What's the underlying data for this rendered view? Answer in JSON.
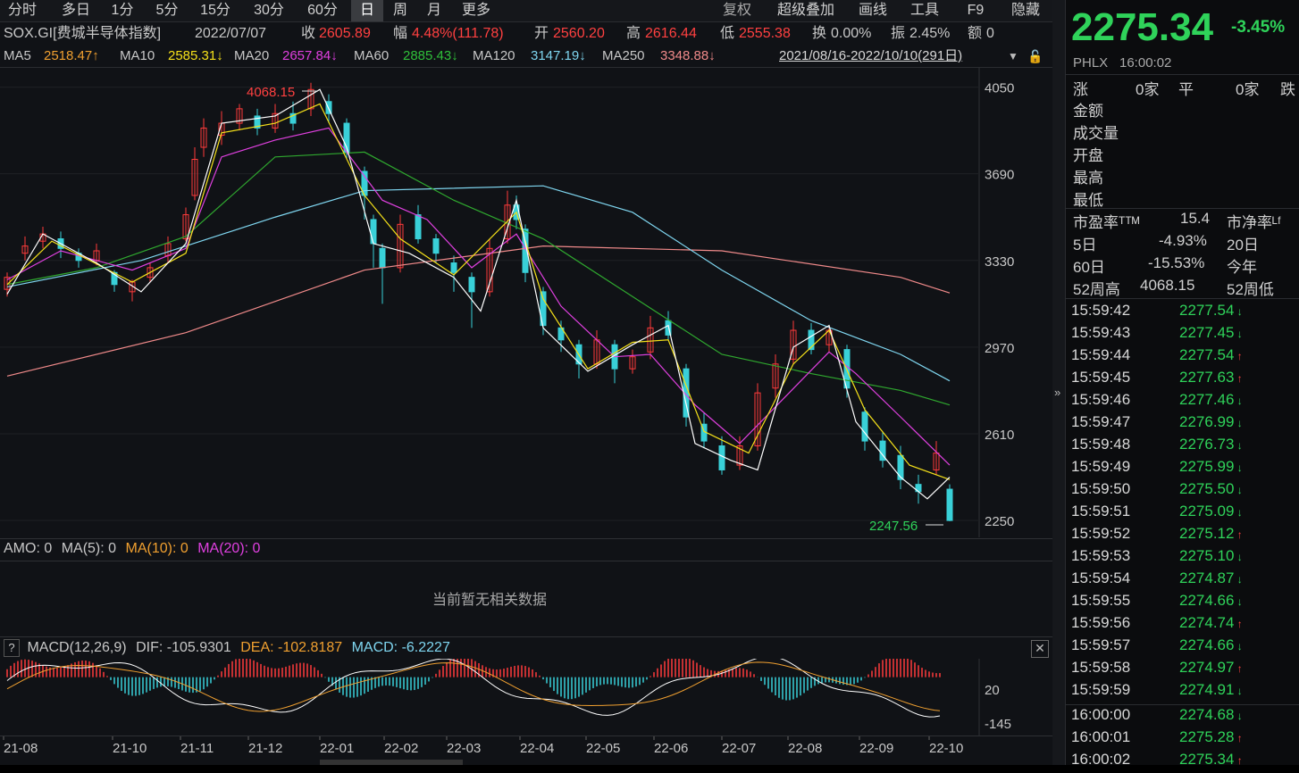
{
  "toolbar": {
    "tabs": [
      "分时",
      "多日",
      "1分",
      "5分",
      "15分",
      "30分",
      "60分",
      "日",
      "周",
      "月",
      "更多"
    ],
    "active_tab": "日",
    "tools": [
      "复权",
      "超级叠加",
      "画线",
      "工具",
      "F9",
      "隐藏"
    ]
  },
  "info": {
    "symbol": "SOX.GI[费城半导体指数]",
    "date": "2022/07/07",
    "close_label": "收",
    "close": "2605.89",
    "change_label": "幅",
    "change": "4.48%(111.78)",
    "open_label": "开",
    "open": "2560.20",
    "high_label": "高",
    "high": "2616.44",
    "low_label": "低",
    "low": "2555.38",
    "turnover_label": "换",
    "turnover": "0.00%",
    "amplitude_label": "振",
    "amplitude": "2.45%",
    "amount_label": "额",
    "amount": "0"
  },
  "ma": {
    "ma5_label": "MA5",
    "ma5": "2518.47↑",
    "ma10_label": "MA10",
    "ma10": "2585.31↓",
    "ma20_label": "MA20",
    "ma20": "2657.84↓",
    "ma60_label": "MA60",
    "ma60": "2885.43↓",
    "ma120_label": "MA120",
    "ma120": "3147.19↓",
    "ma250_label": "MA250",
    "ma250": "3348.88↓",
    "range": "2021/08/16-2022/10/10(291日)"
  },
  "colors": {
    "up": "#ff3b3b",
    "down": "#39d0d8",
    "ma5": "#ffffff",
    "ma10": "#f5e11a",
    "ma20": "#e040e0",
    "ma60": "#2fa82f",
    "ma120": "#7fd6f0",
    "ma250": "#f08a8a",
    "price_green": "#2fd35a",
    "price_red": "#ff4040"
  },
  "chart_data": [
    {
      "type": "line",
      "title": "SOX.GI[费城半导体指数]",
      "y_ticks": [
        "4050",
        "3690",
        "3330",
        "2970",
        "2610",
        "2250"
      ],
      "ylim": [
        2180,
        4130
      ],
      "x_ticks": [
        "21-08",
        "21-10",
        "21-11",
        "21-12",
        "22-01",
        "22-02",
        "22-03",
        "22-04",
        "22-05",
        "22-06",
        "22-07",
        "22-08",
        "22-09",
        "22-10"
      ],
      "annotations": {
        "max_label": "4068.15",
        "min_label": "2247.56"
      },
      "series": [
        {
          "name": "MA250",
          "values": [
            [
              0,
              2850
            ],
            [
              200,
              3030
            ],
            [
              400,
              3290
            ],
            [
              600,
              3390
            ],
            [
              800,
              3370
            ],
            [
              1000,
              3260
            ],
            [
              1055,
              3195
            ]
          ]
        },
        {
          "name": "MA120",
          "values": [
            [
              0,
              3220
            ],
            [
              150,
              3330
            ],
            [
              300,
              3510
            ],
            [
              400,
              3620
            ],
            [
              600,
              3640
            ],
            [
              700,
              3530
            ],
            [
              800,
              3290
            ],
            [
              900,
              3080
            ],
            [
              1000,
              2940
            ],
            [
              1055,
              2830
            ]
          ]
        },
        {
          "name": "MA60",
          "values": [
            [
              0,
              3230
            ],
            [
              100,
              3300
            ],
            [
              200,
              3430
            ],
            [
              300,
              3760
            ],
            [
              400,
              3780
            ],
            [
              500,
              3580
            ],
            [
              600,
              3420
            ],
            [
              700,
              3180
            ],
            [
              800,
              2940
            ],
            [
              900,
              2860
            ],
            [
              1000,
              2790
            ],
            [
              1055,
              2730
            ]
          ]
        },
        {
          "name": "MA20",
          "values": [
            [
              0,
              3250
            ],
            [
              60,
              3370
            ],
            [
              140,
              3290
            ],
            [
              200,
              3380
            ],
            [
              240,
              3760
            ],
            [
              300,
              3830
            ],
            [
              360,
              3880
            ],
            [
              420,
              3580
            ],
            [
              470,
              3500
            ],
            [
              520,
              3300
            ],
            [
              570,
              3440
            ],
            [
              620,
              3140
            ],
            [
              680,
              2930
            ],
            [
              720,
              2940
            ],
            [
              770,
              2730
            ],
            [
              820,
              2570
            ],
            [
              870,
              2760
            ],
            [
              920,
              2950
            ],
            [
              950,
              2860
            ],
            [
              1000,
              2680
            ],
            [
              1055,
              2480
            ]
          ]
        },
        {
          "name": "MA10",
          "values": [
            [
              0,
              3230
            ],
            [
              50,
              3410
            ],
            [
              140,
              3240
            ],
            [
              200,
              3360
            ],
            [
              240,
              3860
            ],
            [
              300,
              3900
            ],
            [
              350,
              3980
            ],
            [
              400,
              3600
            ],
            [
              440,
              3420
            ],
            [
              500,
              3270
            ],
            [
              570,
              3530
            ],
            [
              600,
              3170
            ],
            [
              650,
              2880
            ],
            [
              700,
              2990
            ],
            [
              740,
              3000
            ],
            [
              780,
              2620
            ],
            [
              830,
              2530
            ],
            [
              880,
              2900
            ],
            [
              920,
              3040
            ],
            [
              960,
              2710
            ],
            [
              1010,
              2480
            ],
            [
              1055,
              2420
            ]
          ]
        },
        {
          "name": "MA5",
          "values": [
            [
              0,
              3190
            ],
            [
              40,
              3440
            ],
            [
              100,
              3320
            ],
            [
              150,
              3200
            ],
            [
              200,
              3400
            ],
            [
              240,
              3900
            ],
            [
              300,
              3930
            ],
            [
              350,
              4040
            ],
            [
              380,
              3800
            ],
            [
              410,
              3400
            ],
            [
              450,
              3360
            ],
            [
              500,
              3260
            ],
            [
              530,
              3120
            ],
            [
              570,
              3580
            ],
            [
              600,
              3050
            ],
            [
              650,
              2870
            ],
            [
              700,
              2980
            ],
            [
              740,
              3060
            ],
            [
              770,
              2570
            ],
            [
              810,
              2500
            ],
            [
              840,
              2460
            ],
            [
              880,
              2970
            ],
            [
              920,
              3060
            ],
            [
              950,
              2660
            ],
            [
              1000,
              2430
            ],
            [
              1030,
              2340
            ],
            [
              1055,
              2430
            ]
          ]
        }
      ],
      "candles": [
        [
          0,
          3210,
          3260,
          3180,
          3280
        ],
        [
          20,
          3360,
          3390,
          3330,
          3430
        ],
        [
          40,
          3410,
          3440,
          3380,
          3470
        ],
        [
          60,
          3420,
          3380,
          3340,
          3450
        ],
        [
          80,
          3360,
          3330,
          3300,
          3380
        ],
        [
          100,
          3330,
          3370,
          3310,
          3400
        ],
        [
          120,
          3280,
          3230,
          3200,
          3290
        ],
        [
          140,
          3200,
          3240,
          3160,
          3250
        ],
        [
          160,
          3260,
          3300,
          3240,
          3320
        ],
        [
          180,
          3350,
          3400,
          3320,
          3430
        ],
        [
          200,
          3420,
          3520,
          3410,
          3550
        ],
        [
          210,
          3600,
          3750,
          3580,
          3800
        ],
        [
          220,
          3800,
          3880,
          3760,
          3920
        ],
        [
          240,
          3850,
          3900,
          3810,
          3950
        ],
        [
          260,
          3900,
          3960,
          3870,
          3980
        ],
        [
          280,
          3930,
          3880,
          3850,
          3960
        ],
        [
          300,
          3880,
          3940,
          3860,
          3980
        ],
        [
          320,
          3940,
          3900,
          3870,
          3990
        ],
        [
          340,
          3960,
          4040,
          3930,
          4068
        ],
        [
          360,
          3990,
          3940,
          3900,
          4020
        ],
        [
          380,
          3900,
          3780,
          3750,
          3920
        ],
        [
          400,
          3700,
          3600,
          3500,
          3720
        ],
        [
          410,
          3500,
          3400,
          3300,
          3520
        ],
        [
          420,
          3380,
          3300,
          3150,
          3400
        ],
        [
          440,
          3300,
          3480,
          3280,
          3520
        ],
        [
          460,
          3520,
          3420,
          3400,
          3560
        ],
        [
          480,
          3420,
          3360,
          3320,
          3440
        ],
        [
          500,
          3320,
          3280,
          3200,
          3350
        ],
        [
          520,
          3260,
          3200,
          3050,
          3280
        ],
        [
          540,
          3200,
          3380,
          3180,
          3420
        ],
        [
          560,
          3420,
          3560,
          3400,
          3620
        ],
        [
          570,
          3560,
          3500,
          3460,
          3600
        ],
        [
          580,
          3460,
          3280,
          3240,
          3480
        ],
        [
          600,
          3200,
          3060,
          3020,
          3220
        ],
        [
          620,
          3050,
          3000,
          2950,
          3080
        ],
        [
          640,
          2980,
          2900,
          2840,
          3000
        ],
        [
          660,
          2900,
          3000,
          2880,
          3040
        ],
        [
          680,
          2980,
          2880,
          2820,
          3000
        ],
        [
          700,
          2880,
          2930,
          2860,
          2960
        ],
        [
          720,
          2950,
          3050,
          2920,
          3100
        ],
        [
          740,
          3080,
          3020,
          3000,
          3120
        ],
        [
          760,
          2880,
          2680,
          2640,
          2900
        ],
        [
          780,
          2650,
          2580,
          2550,
          2700
        ],
        [
          800,
          2560,
          2460,
          2440,
          2600
        ],
        [
          820,
          2480,
          2560,
          2460,
          2600
        ],
        [
          840,
          2560,
          2780,
          2540,
          2820
        ],
        [
          860,
          2800,
          2900,
          2760,
          2940
        ],
        [
          880,
          2920,
          3040,
          2900,
          3080
        ],
        [
          900,
          3040,
          2960,
          2940,
          3070
        ],
        [
          920,
          2980,
          3040,
          2950,
          3060
        ],
        [
          940,
          2960,
          2800,
          2760,
          2980
        ],
        [
          960,
          2700,
          2580,
          2540,
          2720
        ],
        [
          980,
          2580,
          2500,
          2470,
          2620
        ],
        [
          1000,
          2520,
          2420,
          2380,
          2560
        ],
        [
          1020,
          2400,
          2370,
          2320,
          2440
        ],
        [
          1040,
          2460,
          2530,
          2440,
          2580
        ],
        [
          1055,
          2380,
          2250,
          2247,
          2400
        ]
      ]
    },
    {
      "type": "bar",
      "title": "MACD(12,26,9)",
      "y_ticks": [
        "20",
        "-145"
      ],
      "ylim": [
        -190,
        60
      ],
      "dif_label": "DIF:",
      "dif": "-105.9301",
      "dea_label": "DEA:",
      "dea": "-102.8187",
      "macd_label": "MACD:",
      "macd": "-6.2227"
    }
  ],
  "volume": {
    "label": "AMO: 0",
    "ma5": "MA(5): 0",
    "ma10": "MA(10): 0",
    "ma20": "MA(20): 0",
    "empty_msg": "当前暂无相关数据"
  },
  "quote": {
    "price": "2275.34",
    "change_pct": "-3.45%",
    "exchange": "PHLX",
    "time": "16:00:02",
    "rise_label": "涨",
    "rise_val": "0家",
    "flat_label": "平",
    "flat_val": "0家",
    "fall_label": "跌",
    "fields": [
      "金额",
      "成交量",
      "开盘",
      "最高",
      "最低"
    ],
    "pe_label": "市盈率ᵀᵀᴹ",
    "pe_val": "15.4",
    "pb_label": "市净率ᴸᶠ",
    "d5_label": "5日",
    "d5_val": "-4.93%",
    "d20_label": "20日",
    "d60_label": "60日",
    "d60_val": "-15.53%",
    "ytd_label": "今年",
    "w52h_label": "52周高",
    "w52h_val": "4068.15",
    "w52l_label": "52周低"
  },
  "ticks": [
    {
      "t": "15:59:42",
      "p": "2277.54",
      "d": "down"
    },
    {
      "t": "15:59:43",
      "p": "2277.45",
      "d": "down"
    },
    {
      "t": "15:59:44",
      "p": "2277.54",
      "d": "up"
    },
    {
      "t": "15:59:45",
      "p": "2277.63",
      "d": "up"
    },
    {
      "t": "15:59:46",
      "p": "2277.46",
      "d": "down"
    },
    {
      "t": "15:59:47",
      "p": "2276.99",
      "d": "down"
    },
    {
      "t": "15:59:48",
      "p": "2276.73",
      "d": "down"
    },
    {
      "t": "15:59:49",
      "p": "2275.99",
      "d": "down"
    },
    {
      "t": "15:59:50",
      "p": "2275.50",
      "d": "down"
    },
    {
      "t": "15:59:51",
      "p": "2275.09",
      "d": "down"
    },
    {
      "t": "15:59:52",
      "p": "2275.12",
      "d": "up"
    },
    {
      "t": "15:59:53",
      "p": "2275.10",
      "d": "down"
    },
    {
      "t": "15:59:54",
      "p": "2274.87",
      "d": "down"
    },
    {
      "t": "15:59:55",
      "p": "2274.66",
      "d": "down"
    },
    {
      "t": "15:59:56",
      "p": "2274.74",
      "d": "up"
    },
    {
      "t": "15:59:57",
      "p": "2274.66",
      "d": "down"
    },
    {
      "t": "15:59:58",
      "p": "2274.97",
      "d": "up"
    },
    {
      "t": "15:59:59",
      "p": "2274.91",
      "d": "down"
    },
    {
      "t": "16:00:00",
      "p": "2274.68",
      "d": "down"
    },
    {
      "t": "16:00:01",
      "p": "2275.28",
      "d": "up"
    },
    {
      "t": "16:00:02",
      "p": "2275.34",
      "d": "up"
    }
  ]
}
